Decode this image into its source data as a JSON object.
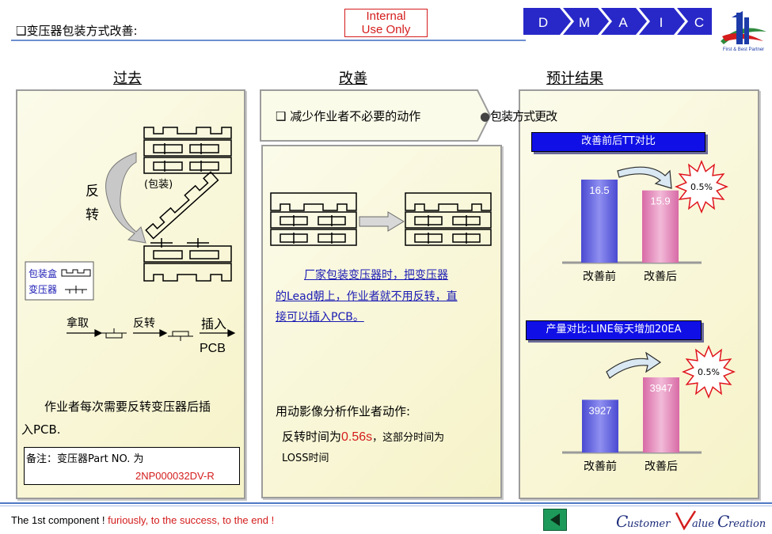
{
  "header": {
    "title": "❑变压器包装方式改善:",
    "internal_line1": "Internal",
    "internal_line2": "Use Only",
    "dmaic": [
      "D",
      "M",
      "A",
      "I",
      "C"
    ],
    "logo_caption": "First & Best Partner"
  },
  "columns": {
    "past": "过去",
    "improve": "改善",
    "expected": "预计结果"
  },
  "past": {
    "flip_label_1": "反",
    "flip_label_2": "转",
    "package_label": "(包装)",
    "legend_box": "包装盒",
    "legend_transformer": "变压器",
    "step_take": "拿取",
    "step_flip": "反转",
    "step_insert": "插入",
    "step_pcb": "PCB",
    "description_line1": "作业者每次需要反转变压器后插",
    "description_line2": "入PCB.",
    "note_line1": "备注：变压器Part NO. 为",
    "note_part_no": "2NP000032DV-R"
  },
  "improve": {
    "headline": "❑ 减少作业者不必要的动作",
    "link_line1": "厂家包装变压器时，把变压器",
    "link_line2": "的Lead朝上，作业者就不用反转，直",
    "link_line3": "接可以插入PCB。",
    "analysis": "用动影像分析作业者动作:",
    "time_prefix": "反转时间为",
    "time_value": "0.56s",
    "time_suffix": "，这部分时间为",
    "loss": "LOSS时间"
  },
  "expected": {
    "overlap_text": "包装方式更改",
    "tt_banner": "改善前后TT对比",
    "output_banner": "产量对比:LINE每天增加20EA",
    "tt_badge": "0.5%",
    "output_badge": "0.5%"
  },
  "chart_data": [
    {
      "type": "bar",
      "title": "改善前后TT对比",
      "categories": [
        "改善前",
        "改善后"
      ],
      "values": [
        16.5,
        15.9
      ],
      "colors": [
        "#4a4ad2",
        "#d86aa6"
      ],
      "annotation": "0.5%"
    },
    {
      "type": "bar",
      "title": "产量对比:LINE每天增加20EA",
      "categories": [
        "改善前",
        "改善后"
      ],
      "values": [
        3927,
        3947
      ],
      "colors": [
        "#4a4ad2",
        "#d86aa6"
      ],
      "annotation": "0.5%"
    }
  ],
  "footer": {
    "text_black": "The 1st component !",
    "text_red": "furiously, to the success, to the end !",
    "brand": "CustomerValueCreation"
  },
  "colors": {
    "accent_blue": "#1010e6",
    "dmaic_blue": "#2828c8",
    "red": "#d41c1c",
    "line": "#6e8fd0"
  }
}
